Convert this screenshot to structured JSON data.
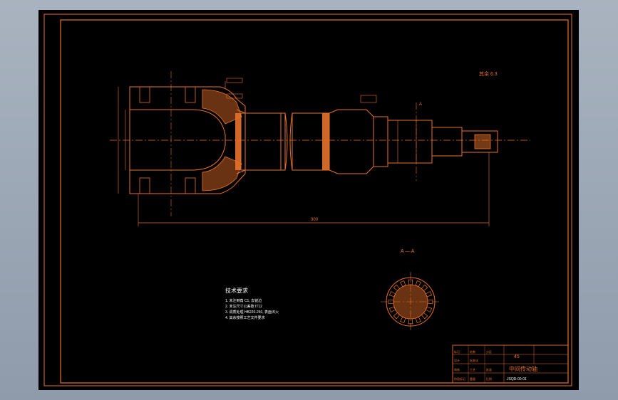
{
  "drawing": {
    "section_label": "A — A",
    "section_marker": "A",
    "material": "45",
    "part_name": "中间传动轴",
    "roughness_note": "其余 6.3",
    "overall_length_dim": "300",
    "tech_requirements": {
      "title": "技术要求",
      "items": [
        "1. 未注倒角 C1, 去锐边",
        "2. 未注尺寸公差按 IT12",
        "3. 调质处理 HB220-250, 表面淬火",
        "4. 其余按照工艺文件要求"
      ]
    },
    "title_block": {
      "cells": [
        "标记",
        "处数",
        "分区",
        "更改文件号",
        "签名",
        "日期",
        "设计",
        "标准化",
        "审核",
        "工艺",
        "批准",
        "阶段标记",
        "重量",
        "比例"
      ],
      "code": "JSQD-00-01"
    }
  },
  "colors": {
    "line": "#e8722a",
    "text_white": "#ffffff",
    "background": "#000000",
    "desktop": "#a9b3c0"
  }
}
